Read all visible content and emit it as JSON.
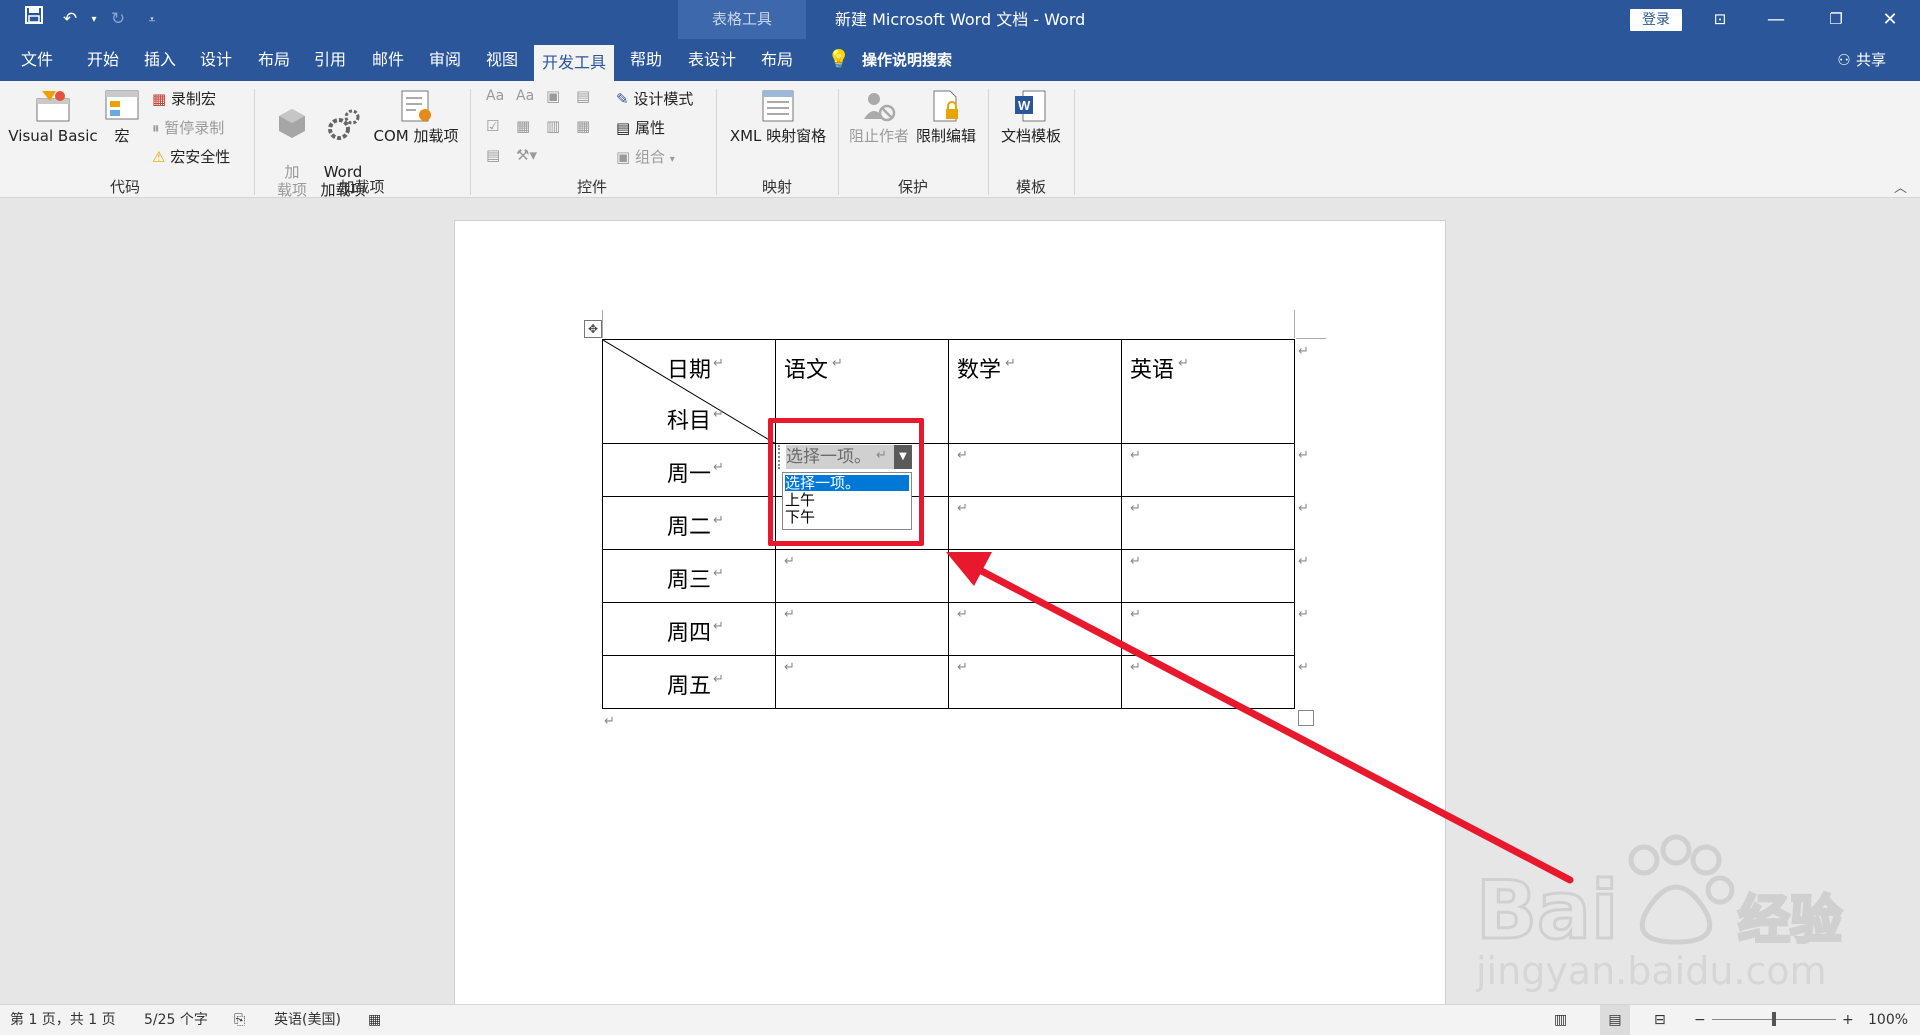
{
  "window": {
    "context_tab_group": "表格工具",
    "title": "新建 Microsoft Word 文档  -  Word",
    "login_label": "登录",
    "share_label": "共享"
  },
  "tabs": [
    "文件",
    "开始",
    "插入",
    "设计",
    "布局",
    "引用",
    "邮件",
    "审阅",
    "视图",
    "开发工具",
    "帮助",
    "表设计",
    "布局"
  ],
  "active_tab_index": 9,
  "search_label": "操作说明搜索",
  "ribbon": {
    "code": {
      "label": "代码",
      "visual_basic": "Visual Basic",
      "macro": "宏",
      "record_macro": "录制宏",
      "pause_record": "暂停录制",
      "macro_security": "宏安全性"
    },
    "addins": {
      "label": "加载项",
      "addin": "加\n载项",
      "word_addins": "Word\n加载项",
      "com_addins": "COM 加载项"
    },
    "controls": {
      "label": "控件",
      "design_mode": "设计模式",
      "properties": "属性",
      "group": "组合"
    },
    "mapping": {
      "label": "映射",
      "xml_pane": "XML 映射窗格"
    },
    "protect": {
      "label": "保护",
      "block_authors": "阻止作者",
      "restrict_editing": "限制编辑"
    },
    "templates": {
      "label": "模板",
      "document_template": "文档模板"
    }
  },
  "table": {
    "header_top": "日期",
    "header_bottom": "科目",
    "columns": [
      "语文",
      "数学",
      "英语"
    ],
    "rows": [
      "周一",
      "周二",
      "周三",
      "周四",
      "周五"
    ]
  },
  "dropdown": {
    "value": "选择一项。",
    "options": [
      "选择一项。",
      "上午",
      "下午"
    ],
    "selected_index": 0
  },
  "statusbar": {
    "page": "第 1 页，共 1 页",
    "words": "5/25 个字",
    "language": "英语(美国)",
    "zoom": "100%"
  },
  "colors": {
    "titlebar": "#2b579a",
    "accent_red": "#e8192c",
    "selection_blue": "#0078d7"
  }
}
